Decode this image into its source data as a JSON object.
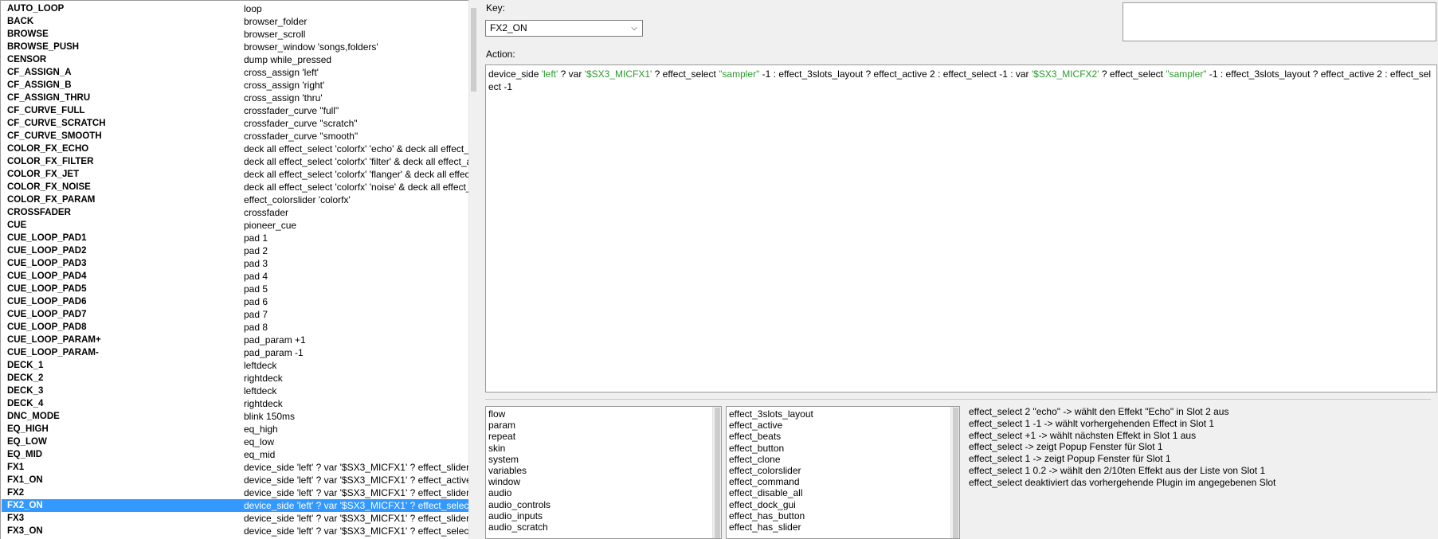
{
  "mappings": [
    {
      "key": "AUTO_LOOP",
      "action": "loop"
    },
    {
      "key": "BACK",
      "action": "browser_folder"
    },
    {
      "key": "BROWSE",
      "action": "browser_scroll"
    },
    {
      "key": "BROWSE_PUSH",
      "action": "browser_window 'songs,folders'"
    },
    {
      "key": "CENSOR",
      "action": "dump while_pressed"
    },
    {
      "key": "CF_ASSIGN_A",
      "action": "cross_assign 'left'"
    },
    {
      "key": "CF_ASSIGN_B",
      "action": "cross_assign 'right'"
    },
    {
      "key": "CF_ASSIGN_THRU",
      "action": "cross_assign 'thru'"
    },
    {
      "key": "CF_CURVE_FULL",
      "action": "crossfader_curve \"full\""
    },
    {
      "key": "CF_CURVE_SCRATCH",
      "action": "crossfader_curve \"scratch\""
    },
    {
      "key": "CF_CURVE_SMOOTH",
      "action": "crossfader_curve \"smooth\""
    },
    {
      "key": "COLOR_FX_ECHO",
      "action": "deck all effect_select 'colorfx' 'echo' & deck all effect_"
    },
    {
      "key": "COLOR_FX_FILTER",
      "action": "deck all effect_select 'colorfx' 'filter' & deck all effect_a"
    },
    {
      "key": "COLOR_FX_JET",
      "action": "deck all effect_select 'colorfx' 'flanger' & deck all effec"
    },
    {
      "key": "COLOR_FX_NOISE",
      "action": "deck all effect_select 'colorfx' 'noise' & deck all effect_"
    },
    {
      "key": "COLOR_FX_PARAM",
      "action": "effect_colorslider 'colorfx'"
    },
    {
      "key": "CROSSFADER",
      "action": "crossfader"
    },
    {
      "key": "CUE",
      "action": "pioneer_cue"
    },
    {
      "key": "CUE_LOOP_PAD1",
      "action": "pad 1"
    },
    {
      "key": "CUE_LOOP_PAD2",
      "action": "pad 2"
    },
    {
      "key": "CUE_LOOP_PAD3",
      "action": "pad 3"
    },
    {
      "key": "CUE_LOOP_PAD4",
      "action": "pad 4"
    },
    {
      "key": "CUE_LOOP_PAD5",
      "action": "pad 5"
    },
    {
      "key": "CUE_LOOP_PAD6",
      "action": "pad 6"
    },
    {
      "key": "CUE_LOOP_PAD7",
      "action": "pad 7"
    },
    {
      "key": "CUE_LOOP_PAD8",
      "action": "pad 8"
    },
    {
      "key": "CUE_LOOP_PARAM+",
      "action": "pad_param +1"
    },
    {
      "key": "CUE_LOOP_PARAM-",
      "action": "pad_param -1"
    },
    {
      "key": "DECK_1",
      "action": "leftdeck"
    },
    {
      "key": "DECK_2",
      "action": "rightdeck"
    },
    {
      "key": "DECK_3",
      "action": "leftdeck"
    },
    {
      "key": "DECK_4",
      "action": "rightdeck"
    },
    {
      "key": "DNC_MODE",
      "action": "blink 150ms"
    },
    {
      "key": "EQ_HIGH",
      "action": "eq_high"
    },
    {
      "key": "EQ_LOW",
      "action": "eq_low"
    },
    {
      "key": "EQ_MID",
      "action": " eq_mid"
    },
    {
      "key": "FX1",
      "action": "device_side 'left' ? var '$SX3_MICFX1' ? effect_slider"
    },
    {
      "key": "FX1_ON",
      "action": "device_side 'left' ? var '$SX3_MICFX1' ? effect_active"
    },
    {
      "key": "FX2",
      "action": "device_side 'left' ? var '$SX3_MICFX1' ? effect_slider"
    },
    {
      "key": "FX2_ON",
      "action": "device_side 'left' ? var '$SX3_MICFX1' ? effect_selec"
    },
    {
      "key": "FX3",
      "action": "device_side 'left' ? var '$SX3_MICFX1' ? effect_slider"
    },
    {
      "key": "FX3_ON",
      "action": "device_side 'left' ? var '$SX3_MICFX1' ? effect_selec"
    }
  ],
  "selected_index": 39,
  "editor": {
    "key_label": "Key:",
    "key_value": "FX2_ON",
    "action_label": "Action:",
    "notes_value": "",
    "action_segments": [
      {
        "t": "device_side ",
        "c": "plain"
      },
      {
        "t": "'left'",
        "c": "str"
      },
      {
        "t": " ? var ",
        "c": "plain"
      },
      {
        "t": "'$SX3_MICFX1'",
        "c": "str"
      },
      {
        "t": " ? effect_select ",
        "c": "plain"
      },
      {
        "t": "\"sampler\"",
        "c": "str"
      },
      {
        "t": " -1 : effect_3slots_layout ? effect_active 2 : effect_select -1 : var ",
        "c": "plain"
      },
      {
        "t": "'$SX3_MICFX2'",
        "c": "str"
      },
      {
        "t": " ? effect_select ",
        "c": "plain"
      },
      {
        "t": "\"sampler\"",
        "c": "str"
      },
      {
        "t": " -1 : effect_3slots_layout ? effect_active 2 : effect_select -1",
        "c": "plain"
      }
    ]
  },
  "categories": [
    "flow",
    "param",
    "repeat",
    "skin",
    "system",
    "variables",
    "window",
    "audio",
    "audio_controls",
    "audio_inputs",
    "audio_scratch"
  ],
  "commands": [
    "effect_3slots_layout",
    "effect_active",
    "effect_beats",
    "effect_button",
    "effect_clone",
    "effect_colorslider",
    "effect_command",
    "effect_disable_all",
    "effect_dock_gui",
    "effect_has_button",
    "effect_has_slider"
  ],
  "help_lines": [
    "effect_select 2 \"echo\" -> wählt den Effekt \"Echo\" in Slot 2 aus",
    "effect_select 1 -1 -> wählt vorhergehenden Effect in Slot 1",
    "effect_select +1 -> wählt nächsten Effekt in Slot 1 aus",
    "effect_select -> zeigt Popup Fenster für Slot 1",
    "effect_select 1 -> zeigt Popup Fenster für Slot 1",
    "effect_select 1 0.2 -> wählt den 2/10ten Effekt aus der Liste von Slot 1",
    "effect_select deaktiviert das vorhergehende Plugin im angegebenen Slot"
  ],
  "icons": {
    "dropdown": "chevron-down-icon"
  },
  "colors": {
    "selection": "#3399ff",
    "string_literal": "#2a9a2a"
  }
}
